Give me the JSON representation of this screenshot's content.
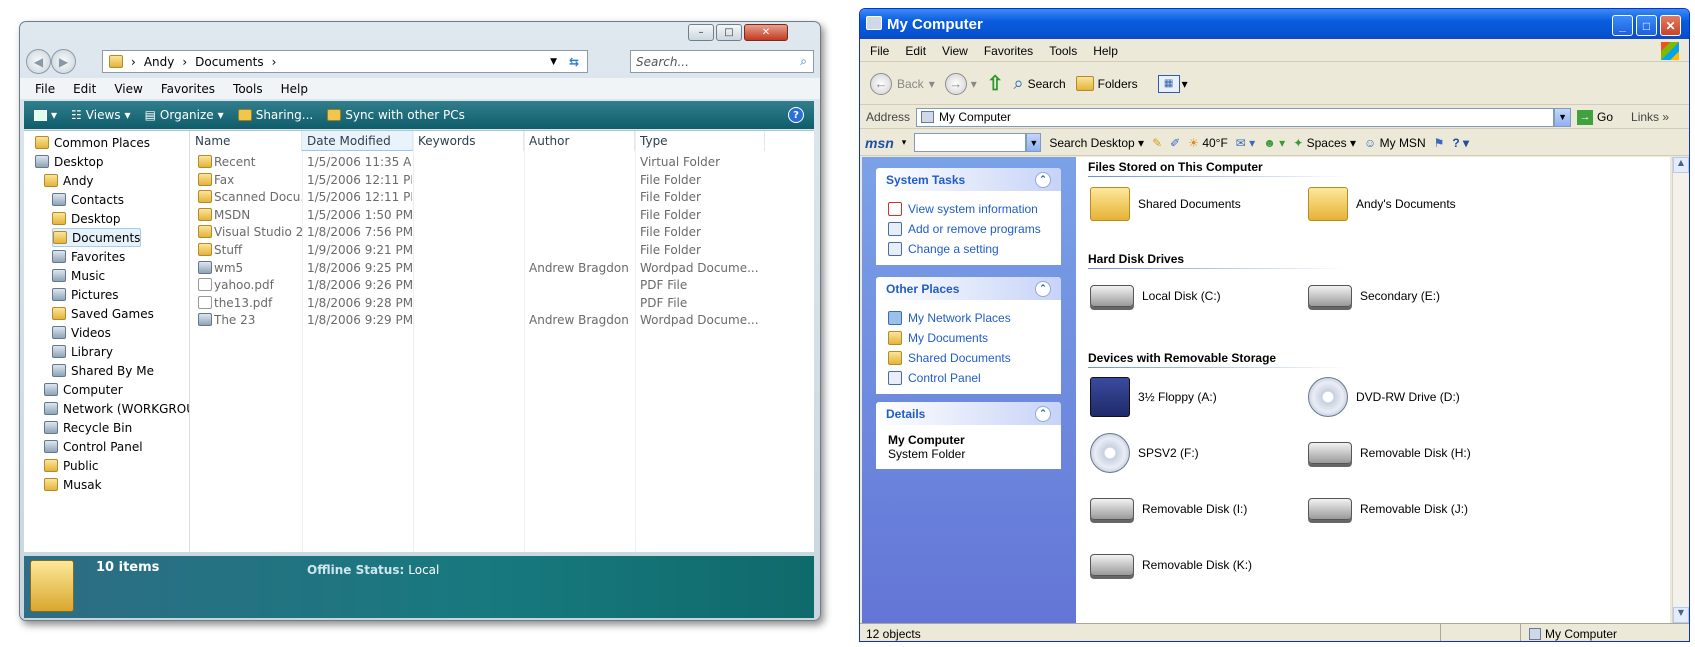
{
  "vista": {
    "address": {
      "crumbs": [
        "Andy",
        "Documents"
      ]
    },
    "search_placeholder": "Search...",
    "menu": [
      "File",
      "Edit",
      "View",
      "Favorites",
      "Tools",
      "Help"
    ],
    "toolbar": {
      "views": "Views",
      "organize": "Organize",
      "sharing": "Sharing...",
      "sync": "Sync with other PCs"
    },
    "tree": [
      {
        "label": "Common Places",
        "indent": 0,
        "icon": "folder-icon"
      },
      {
        "label": "Desktop",
        "indent": 0,
        "icon": "desktop-icon"
      },
      {
        "label": "Andy",
        "indent": 1,
        "icon": "folder-icon"
      },
      {
        "label": "Contacts",
        "indent": 2,
        "icon": "contacts-icon"
      },
      {
        "label": "Desktop",
        "indent": 2,
        "icon": "folder-icon"
      },
      {
        "label": "Documents",
        "indent": 2,
        "icon": "folder-icon",
        "selected": true
      },
      {
        "label": "Favorites",
        "indent": 2,
        "icon": "star-icon"
      },
      {
        "label": "Music",
        "indent": 2,
        "icon": "music-icon"
      },
      {
        "label": "Pictures",
        "indent": 2,
        "icon": "pictures-icon"
      },
      {
        "label": "Saved Games",
        "indent": 2,
        "icon": "folder-icon"
      },
      {
        "label": "Videos",
        "indent": 2,
        "icon": "videos-icon"
      },
      {
        "label": "Library",
        "indent": 2,
        "icon": "library-icon"
      },
      {
        "label": "Shared By Me",
        "indent": 2,
        "icon": "shared-icon"
      },
      {
        "label": "Computer",
        "indent": 1,
        "icon": "computer-icon"
      },
      {
        "label": "Network (WORKGROU",
        "indent": 1,
        "icon": "network-icon"
      },
      {
        "label": "Recycle Bin",
        "indent": 1,
        "icon": "recycle-bin-icon"
      },
      {
        "label": "Control Panel",
        "indent": 1,
        "icon": "control-panel-icon"
      },
      {
        "label": "Public",
        "indent": 1,
        "icon": "folder-icon"
      },
      {
        "label": "Musak",
        "indent": 1,
        "icon": "folder-icon"
      }
    ],
    "columns": [
      "Name",
      "Date Modified",
      "Keywords",
      "Author",
      "Type"
    ],
    "files": [
      {
        "name": "Recent",
        "date": "1/5/2006 11:35 AM",
        "keywords": "",
        "author": "",
        "type": "Virtual Folder",
        "icon": "folder-icon"
      },
      {
        "name": "Fax",
        "date": "1/5/2006 12:11 PM",
        "keywords": "",
        "author": "",
        "type": "File Folder",
        "icon": "folder-icon"
      },
      {
        "name": "Scanned Docu...",
        "date": "1/5/2006 12:11 PM",
        "keywords": "",
        "author": "",
        "type": "File Folder",
        "icon": "folder-icon"
      },
      {
        "name": "MSDN",
        "date": "1/5/2006 1:50 PM",
        "keywords": "",
        "author": "",
        "type": "File Folder",
        "icon": "folder-icon"
      },
      {
        "name": "Visual Studio 2...",
        "date": "1/8/2006 7:56 PM",
        "keywords": "",
        "author": "",
        "type": "File Folder",
        "icon": "folder-icon"
      },
      {
        "name": "Stuff",
        "date": "1/9/2006 9:21 PM",
        "keywords": "",
        "author": "",
        "type": "File Folder",
        "icon": "folder-icon"
      },
      {
        "name": "wm5",
        "date": "1/8/2006 9:25 PM",
        "keywords": "",
        "author": "Andrew Bragdon",
        "type": "Wordpad Docume...",
        "icon": "wordpad-icon"
      },
      {
        "name": "yahoo.pdf",
        "date": "1/8/2006 9:26 PM",
        "keywords": "",
        "author": "",
        "type": "PDF File",
        "icon": "file-icon"
      },
      {
        "name": "the13.pdf",
        "date": "1/8/2006 9:28 PM",
        "keywords": "",
        "author": "",
        "type": "PDF File",
        "icon": "file-icon"
      },
      {
        "name": "The 23",
        "date": "1/8/2006 9:29 PM",
        "keywords": "",
        "author": "Andrew Bragdon",
        "type": "Wordpad Docume...",
        "icon": "wordpad-icon"
      }
    ],
    "status": {
      "count": "10 items",
      "offline_label": "Offline Status:",
      "offline_value": "Local"
    }
  },
  "xp": {
    "title": "My Computer",
    "menu": [
      "File",
      "Edit",
      "View",
      "Favorites",
      "Tools",
      "Help"
    ],
    "toolbar": {
      "back": "Back",
      "search": "Search",
      "folders": "Folders"
    },
    "address_label": "Address",
    "address_value": "My Computer",
    "go": "Go",
    "links": "Links",
    "msn": {
      "brand": "msn",
      "search_desktop": "Search Desktop",
      "weather": "40°F",
      "spaces": "Spaces",
      "mymsn": "My MSN"
    },
    "system_tasks": {
      "title": "System Tasks",
      "links": [
        "View system information",
        "Add or remove programs",
        "Change a setting"
      ]
    },
    "other_places": {
      "title": "Other Places",
      "links": [
        "My Network Places",
        "My Documents",
        "Shared Documents",
        "Control Panel"
      ]
    },
    "details": {
      "title": "Details",
      "name": "My Computer",
      "sub": "System Folder"
    },
    "groups": {
      "stored": {
        "title": "Files Stored on This Computer",
        "items": [
          "Shared Documents",
          "Andy's Documents"
        ]
      },
      "hdd": {
        "title": "Hard Disk Drives",
        "items": [
          "Local Disk (C:)",
          "Secondary (E:)"
        ]
      },
      "removable": {
        "title": "Devices with Removable Storage",
        "items": [
          "3½ Floppy (A:)",
          "DVD-RW Drive (D:)",
          "SPSV2 (F:)",
          "Removable Disk (H:)",
          "Removable Disk (I:)",
          "Removable Disk (J:)",
          "Removable Disk (K:)"
        ]
      }
    },
    "status": {
      "objects": "12 objects",
      "location": "My Computer"
    }
  }
}
